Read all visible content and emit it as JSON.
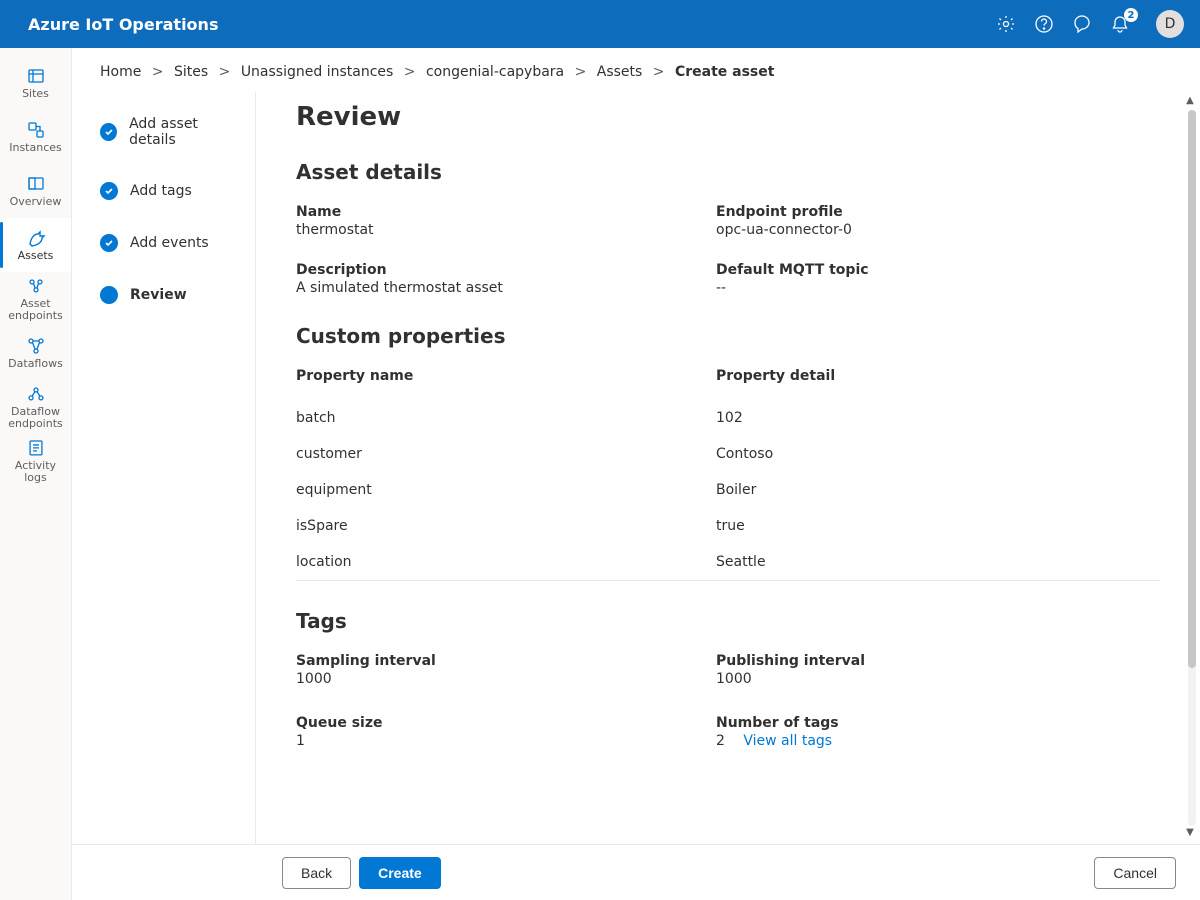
{
  "app_title": "Azure IoT Operations",
  "header": {
    "notification_count": "2",
    "avatar_initial": "D"
  },
  "rail": [
    {
      "key": "sites",
      "label": "Sites"
    },
    {
      "key": "instances",
      "label": "Instances"
    },
    {
      "key": "overview",
      "label": "Overview"
    },
    {
      "key": "assets",
      "label": "Assets",
      "active": true
    },
    {
      "key": "asset-endpoints",
      "label": "Asset endpoints"
    },
    {
      "key": "dataflows",
      "label": "Dataflows"
    },
    {
      "key": "dataflow-endpoints",
      "label": "Dataflow endpoints"
    },
    {
      "key": "activity-logs",
      "label": "Activity logs"
    }
  ],
  "breadcrumb": {
    "items": [
      "Home",
      "Sites",
      "Unassigned instances",
      "congenial-capybara",
      "Assets"
    ],
    "current": "Create asset",
    "sep": ">"
  },
  "steps": [
    {
      "label": "Add asset details",
      "state": "done"
    },
    {
      "label": "Add tags",
      "state": "done"
    },
    {
      "label": "Add events",
      "state": "done"
    },
    {
      "label": "Review",
      "state": "active"
    }
  ],
  "page": {
    "title": "Review",
    "asset_details": {
      "heading": "Asset details",
      "name_label": "Name",
      "name_value": "thermostat",
      "endpoint_label": "Endpoint profile",
      "endpoint_value": "opc-ua-connector-0",
      "description_label": "Description",
      "description_value": "A simulated thermostat asset",
      "mqtt_label": "Default MQTT topic",
      "mqtt_value": "--"
    },
    "custom_properties": {
      "heading": "Custom properties",
      "col_name": "Property name",
      "col_detail": "Property detail",
      "rows": [
        {
          "name": "batch",
          "detail": "102"
        },
        {
          "name": "customer",
          "detail": "Contoso"
        },
        {
          "name": "equipment",
          "detail": "Boiler"
        },
        {
          "name": "isSpare",
          "detail": "true"
        },
        {
          "name": "location",
          "detail": "Seattle"
        }
      ]
    },
    "tags": {
      "heading": "Tags",
      "sampling_label": "Sampling interval",
      "sampling_value": "1000",
      "publishing_label": "Publishing interval",
      "publishing_value": "1000",
      "queue_label": "Queue size",
      "queue_value": "1",
      "count_label": "Number of tags",
      "count_value": "2",
      "view_all": "View all tags"
    }
  },
  "footer": {
    "back": "Back",
    "create": "Create",
    "cancel": "Cancel"
  }
}
